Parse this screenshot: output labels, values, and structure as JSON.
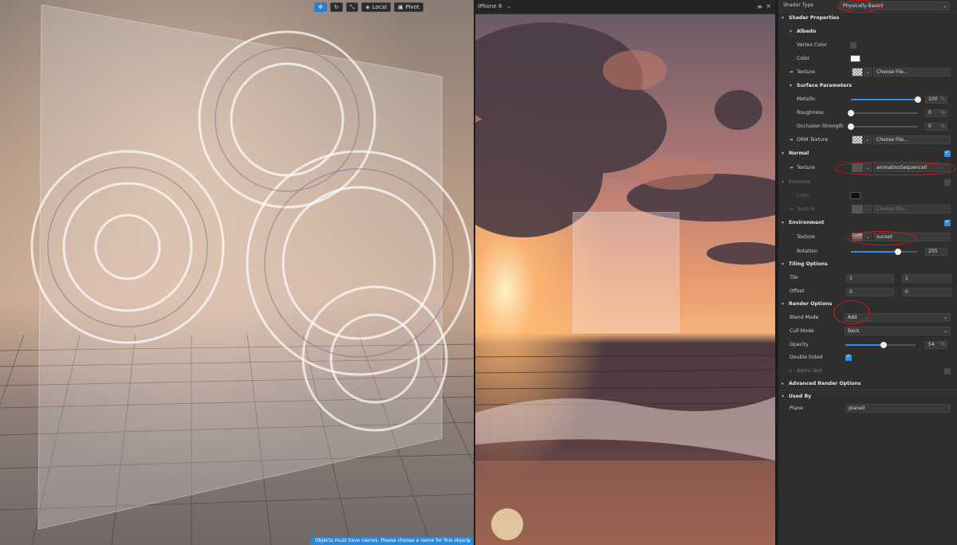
{
  "viewport": {
    "toolbar": {
      "local_label": "Local",
      "pivot_label": "Pivot"
    },
    "toast_message": "Objects must have names. Please choose a name for this object.",
    "toast_close": "×"
  },
  "preview": {
    "device": "iPhone 8",
    "device_arrow": "⌄",
    "menu_icon": "≡",
    "close_icon": "×"
  },
  "inspector": {
    "shader_type": {
      "label": "Shader Type",
      "value": "Physically-Based"
    },
    "shader_properties": {
      "title": "Shader Properties"
    },
    "albedo": {
      "title": "Albedo",
      "vertex_color_label": "Vertex Color",
      "color_label": "Color",
      "texture_label": "Texture",
      "texture_value": "Choose File..."
    },
    "surface": {
      "title": "Surface Parameters",
      "metallic_label": "Metallic",
      "metallic_value": "100",
      "metallic_fraction": 1.0,
      "roughness_label": "Roughness",
      "roughness_value": "0",
      "roughness_fraction": 0.0,
      "occlusion_label": "Occlusion Strength",
      "occlusion_value": "0",
      "occlusion_fraction": 0.0,
      "orm_label": "ORM Texture",
      "orm_value": "Choose File...",
      "pct": "%"
    },
    "normal": {
      "title": "Normal",
      "enabled": true,
      "texture_label": "Texture",
      "texture_value": "animationSequence0"
    },
    "emission": {
      "title": "Emission",
      "enabled": false,
      "color_label": "Color",
      "texture_label": "Texture",
      "texture_value": "Choose File..."
    },
    "environment": {
      "title": "Environment",
      "enabled": true,
      "texture_label": "Texture",
      "texture_value": "sunset",
      "rotation_label": "Rotation",
      "rotation_value": "255",
      "rotation_fraction": 0.708
    },
    "tiling": {
      "title": "Tiling Options",
      "tile_label": "Tile",
      "tile_x": "1",
      "tile_y": "1",
      "offset_label": "Offset",
      "offset_x": "0",
      "offset_y": "0"
    },
    "render": {
      "title": "Render Options",
      "blend_label": "Blend Mode",
      "blend_value": "Add",
      "cull_label": "Cull Mode",
      "cull_value": "Back",
      "opacity_label": "Opacity",
      "opacity_value": "54",
      "opacity_fraction": 0.54,
      "double_label": "Double Sided",
      "double_enabled": true,
      "alpha_label": "Alpha Test",
      "alpha_enabled": false
    },
    "advanced": {
      "title": "Advanced Render Options"
    },
    "used_by": {
      "title": "Used By",
      "plane_label": "Plane",
      "plane_value": "plane0"
    },
    "collapse_icon": "▾",
    "expand_icon": "▸",
    "dropdown_arrow": "⌄",
    "link_icon": "⇥"
  },
  "colors": {
    "accent": "#2d8ee6",
    "toast": "#2f86d6",
    "annotation": "#d01818",
    "panel_bg": "#2e2e2e"
  }
}
